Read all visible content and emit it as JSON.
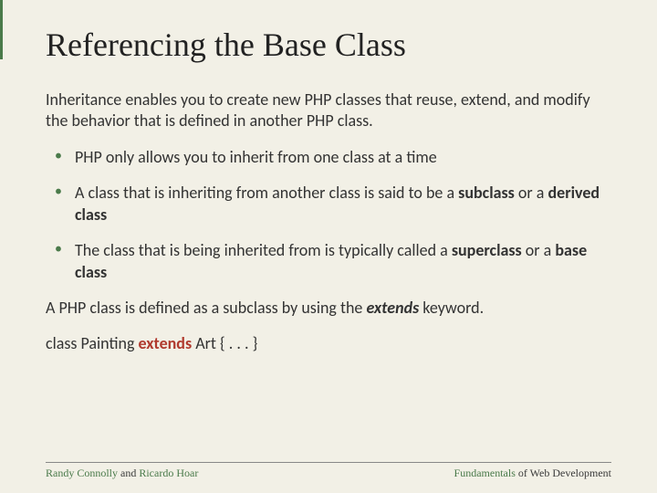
{
  "title": "Referencing the Base Class",
  "intro": "Inheritance enables you to create new PHP classes that reuse, extend, and modify the behavior that is defined in another PHP class.",
  "bullets": [
    {
      "text_pre": "PHP only allows you to inherit from one class at a time",
      "bold1": "",
      "mid": "",
      "bold2": "",
      "post": ""
    },
    {
      "text_pre": "A class that is inheriting from another class is said to be a ",
      "bold1": "subclass",
      "mid": " or a ",
      "bold2": "derived class",
      "post": ""
    },
    {
      "text_pre": "The class that is being inherited from is typically called a ",
      "bold1": "superclass",
      "mid": " or a ",
      "bold2": "base class",
      "post": ""
    }
  ],
  "para2_pre": "A PHP class is defined as a subclass by using the ",
  "para2_kw": "extends",
  "para2_post": " keyword.",
  "code_pre": "class Painting ",
  "code_kw": "extends",
  "code_post": " Art { . . . }",
  "footer": {
    "author1": "Randy Connolly",
    "and": " and ",
    "author2": "Ricardo Hoar",
    "right_pre": "Fundamentals",
    "right_post": " of Web Development"
  }
}
